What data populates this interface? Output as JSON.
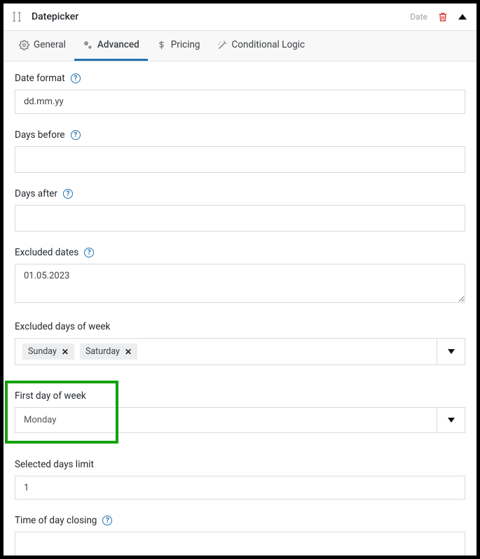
{
  "header": {
    "title": "Datepicker",
    "type_label": "Date"
  },
  "tabs": {
    "general": "General",
    "advanced": "Advanced",
    "pricing": "Pricing",
    "conditional": "Conditional Logic"
  },
  "fields": {
    "date_format": {
      "label": "Date format",
      "value": "dd.mm.yy"
    },
    "days_before": {
      "label": "Days before",
      "value": ""
    },
    "days_after": {
      "label": "Days after",
      "value": ""
    },
    "excluded_dates": {
      "label": "Excluded dates",
      "value": "01.05.2023"
    },
    "excluded_days_of_week": {
      "label": "Excluded days of week",
      "values": [
        "Sunday",
        "Saturday"
      ]
    },
    "first_day_of_week": {
      "label": "First day of week",
      "value": "Monday"
    },
    "selected_days_limit": {
      "label": "Selected days limit",
      "value": "1"
    },
    "time_of_day_closing": {
      "label": "Time of day closing",
      "value": ""
    }
  }
}
